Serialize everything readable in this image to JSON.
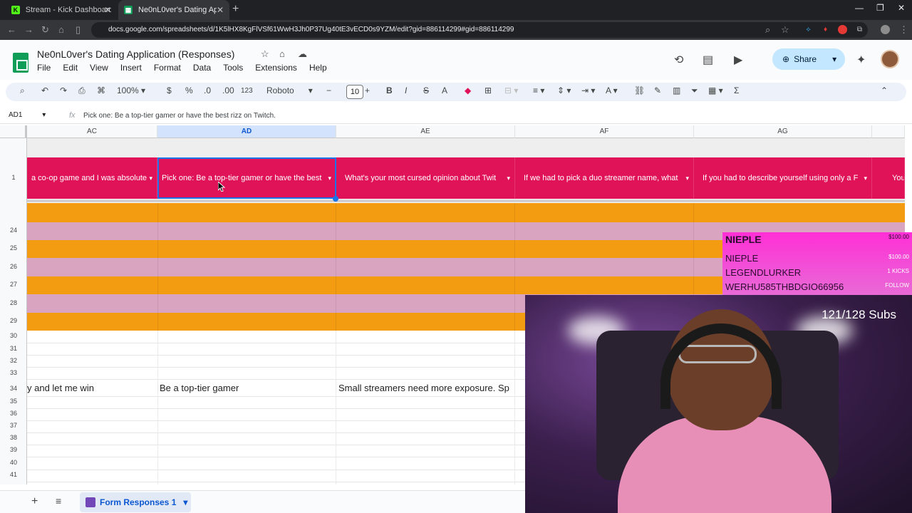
{
  "browser": {
    "tabs": [
      {
        "title": "Stream - Kick Dashboard",
        "favicon": "K",
        "active": false
      },
      {
        "title": "Ne0nL0ver's Dating Application",
        "favicon": "▦",
        "active": true
      }
    ],
    "url": "docs.google.com/spreadsheets/d/1K5lHX8KgFlVSf61WwH3Jh0P37Ug40tE3vECD0s9YZM/edit?gid=886114299#gid=886114299"
  },
  "doc": {
    "title": "Ne0nL0ver's Dating Application (Responses)",
    "menus": [
      "File",
      "Edit",
      "View",
      "Insert",
      "Format",
      "Data",
      "Tools",
      "Extensions",
      "Help"
    ],
    "share_label": "Share"
  },
  "toolbar": {
    "zoom": "100%",
    "currency": "$",
    "percent": "%",
    "decrease_decimal": ".0",
    "increase_decimal": ".00",
    "number_format": "123",
    "font": "Roboto",
    "font_size": "10",
    "bold": "B",
    "italic": "I",
    "strike": "S",
    "text_color": "A",
    "sum": "Σ"
  },
  "formula_bar": {
    "cell_ref": "AD1",
    "fx": "fx",
    "content": "Pick one: Be a top-tier gamer or have the best rizz on Twitch."
  },
  "columns": [
    "AC",
    "AD",
    "AE",
    "AF",
    "AG"
  ],
  "selected_column": "AD",
  "header_row": {
    "row_number": "1",
    "cells": [
      "a co-op game and I was absolute",
      "Pick one: Be a top-tier gamer or have the best",
      "What's your most cursed opinion about Twit",
      "If we had to pick a duo streamer name, what",
      "If you had to describe yourself using only a F",
      "You ge"
    ]
  },
  "row_numbers": [
    "24",
    "25",
    "26",
    "27",
    "28",
    "29",
    "30",
    "31",
    "32",
    "33",
    "34",
    "35",
    "36",
    "37",
    "38",
    "39",
    "40",
    "41"
  ],
  "row34": {
    "ac": "y and let me win",
    "ad": "Be a top-tier gamer",
    "ae": "Small streamers need more exposure. Sp"
  },
  "sheet_tab": "Form Responses 1",
  "colors": {
    "header_pink": "#e01359",
    "orange_band": "#f39c12",
    "pink_band": "#d9a4c0",
    "selection_blue": "#1a73e8"
  },
  "overlay": {
    "alerts": [
      {
        "name": "NIEPLE",
        "value": "$100.00"
      },
      {
        "name": "NIEPLE",
        "value": "$100.00"
      },
      {
        "name": "LEGENDLURKER",
        "value": "1 KICKS"
      },
      {
        "name": "WERHU585THBDGIO66956",
        "value": "FOLLOW"
      }
    ],
    "subs": "121/128 Subs"
  }
}
